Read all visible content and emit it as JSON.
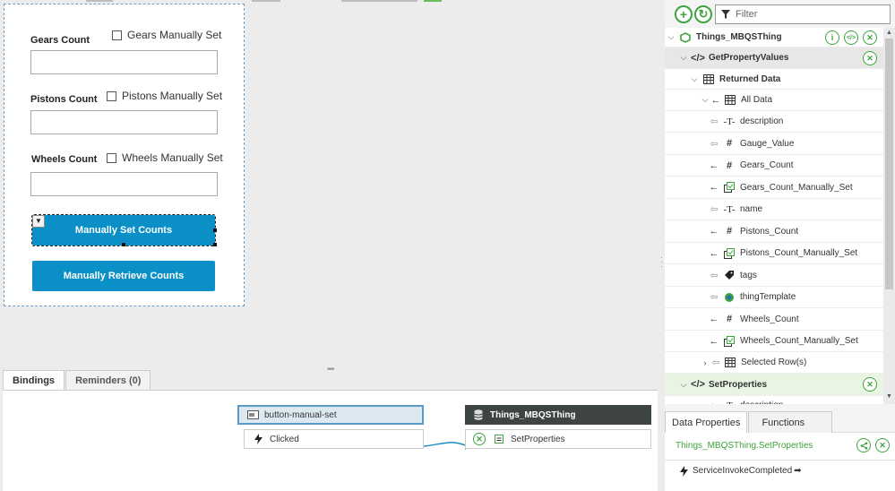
{
  "canvas": {
    "fields": [
      {
        "label": "Gears Count",
        "checkbox": "Gears Manually Set"
      },
      {
        "label": "Pistons Count",
        "checkbox": "Pistons Manually Set"
      },
      {
        "label": "Wheels Count",
        "checkbox": "Wheels Manually Set"
      }
    ],
    "buttons": {
      "set": "Manually Set Counts",
      "retrieve": "Manually Retrieve Counts"
    }
  },
  "bindings": {
    "tabs": [
      "Bindings",
      "Reminders (0)"
    ],
    "source": {
      "name": "button-manual-set",
      "event": "Clicked"
    },
    "target": {
      "name": "Things_MBQSThing",
      "service": "SetProperties"
    }
  },
  "explorer": {
    "filter_placeholder": "Filter",
    "tree": [
      {
        "label": "Things_MBQSThing",
        "icon": "thing-icon"
      },
      {
        "label": "GetPropertyValues",
        "icon": "service-icon"
      },
      {
        "label": "Returned Data",
        "icon": "table-icon"
      },
      {
        "label": "All Data",
        "icon": "table-icon"
      },
      {
        "label": "description",
        "icon": "text-type-icon"
      },
      {
        "label": "Gauge_Value",
        "icon": "number-type-icon"
      },
      {
        "label": "Gears_Count",
        "icon": "number-type-icon"
      },
      {
        "label": "Gears_Count_Manually_Set",
        "icon": "boolean-type-icon"
      },
      {
        "label": "name",
        "icon": "text-type-icon"
      },
      {
        "label": "Pistons_Count",
        "icon": "number-type-icon"
      },
      {
        "label": "Pistons_Count_Manually_Set",
        "icon": "boolean-type-icon"
      },
      {
        "label": "tags",
        "icon": "tag-icon"
      },
      {
        "label": "thingTemplate",
        "icon": "template-icon"
      },
      {
        "label": "Wheels_Count",
        "icon": "number-type-icon"
      },
      {
        "label": "Wheels_Count_Manually_Set",
        "icon": "boolean-type-icon"
      },
      {
        "label": "Selected Row(s)",
        "icon": "table-icon"
      },
      {
        "label": "SetProperties",
        "icon": "service-icon"
      },
      {
        "label": "description",
        "icon": "text-type-icon"
      }
    ]
  },
  "data_properties": {
    "tabs": [
      "Data Properties",
      "Functions"
    ],
    "title": "Things_MBQSThing.SetProperties",
    "event": "ServiceInvokeCompleted"
  },
  "colors": {
    "accent_green": "#3fa33f",
    "button_blue": "#0a8fc7",
    "binding_line": "#1e8fc0"
  }
}
